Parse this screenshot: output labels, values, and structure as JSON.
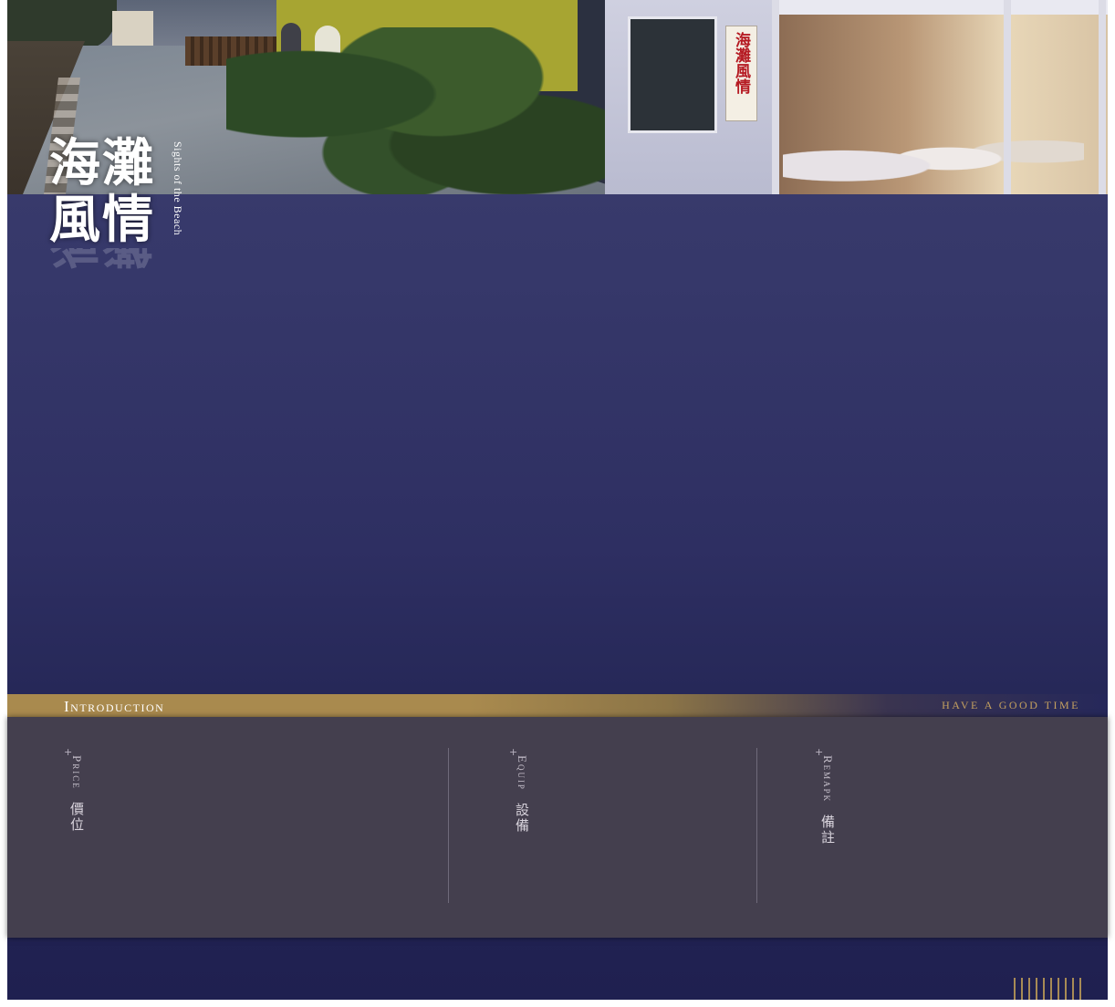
{
  "header": {
    "sign_text": "海灘風情",
    "title_zh": "海灘風情",
    "title_en": "Sights of the Beach"
  },
  "intro": {
    "title": "Introduction",
    "tagline": "have a good time"
  },
  "sections": [
    {
      "plus": "+",
      "label_en": "Price",
      "label_zh": "價位"
    },
    {
      "plus": "+",
      "label_en": "Equip",
      "label_zh": "設備"
    },
    {
      "plus": "+",
      "label_en": "Remapk",
      "label_zh": "備註"
    }
  ],
  "colors": {
    "background": "#ffffff",
    "page_navy": "#2e2f62",
    "gold_bar": "#a98a4e",
    "tagline": "#c4a05f",
    "panel": "#443f4e",
    "divider": "#6f6a7a"
  }
}
